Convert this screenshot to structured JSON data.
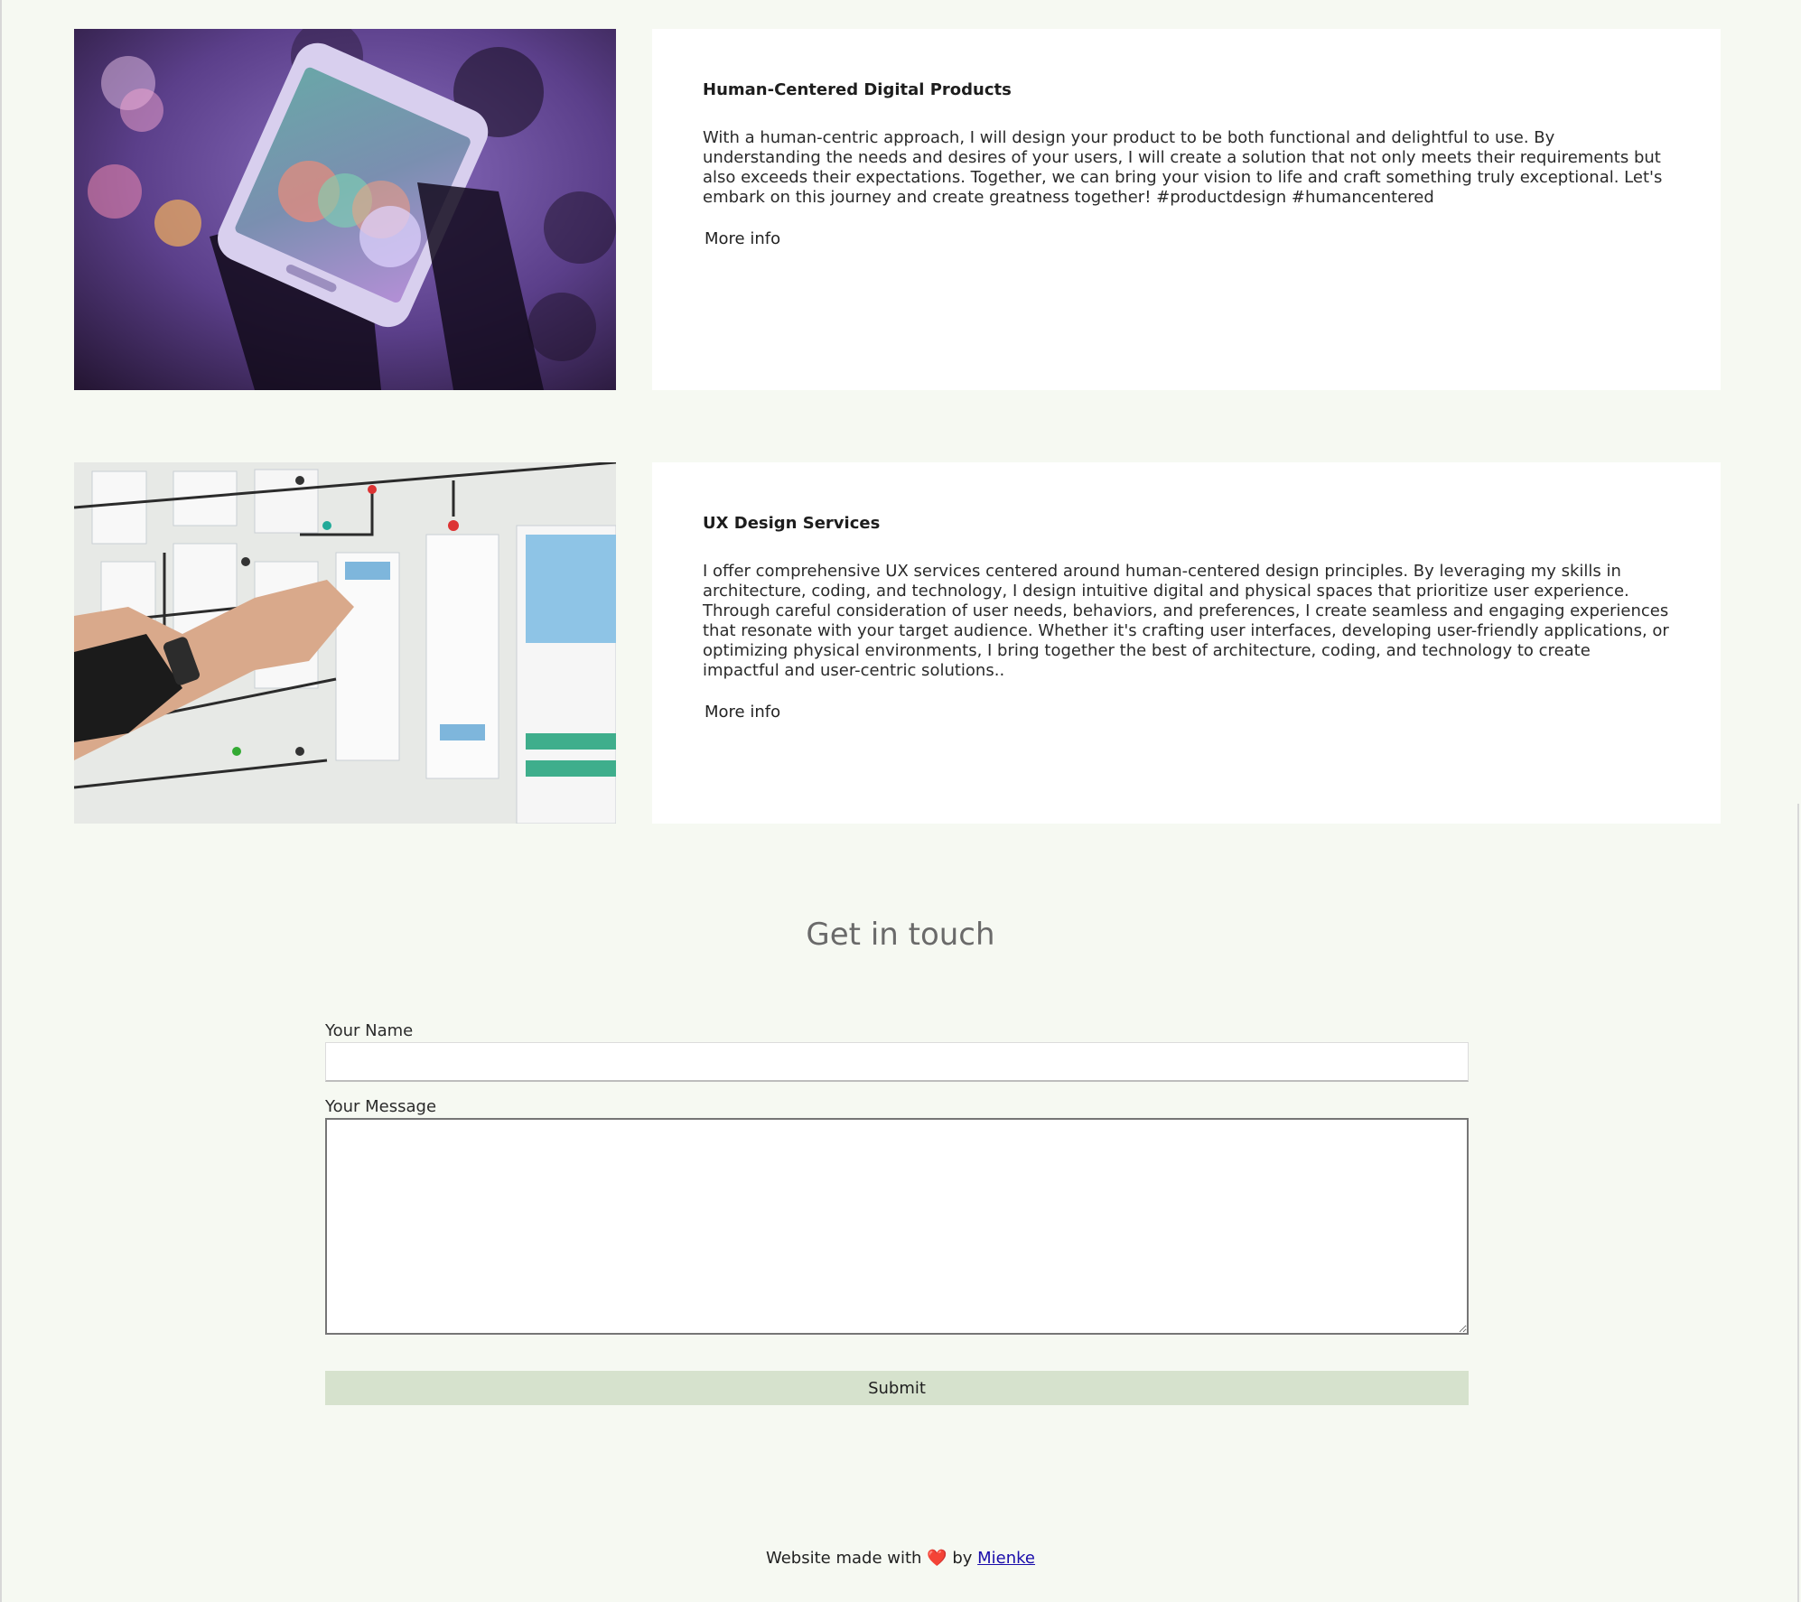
{
  "services": [
    {
      "title": "Human-Centered Digital Products",
      "description": "With a human-centric approach, I will design your product to be both functional and delightful to use. By understanding the needs and desires of your users, I will create a solution that not only meets their requirements but also exceeds their expectations. Together, we can bring your vision to life and craft something truly exceptional. Let's embark on this journey and create greatness together! #productdesign #humancentered",
      "more_label": "More info"
    },
    {
      "title": "UX Design Services",
      "description": "I offer comprehensive UX services centered around human-centered design principles. By leveraging my skills in architecture, coding, and technology, I design intuitive digital and physical spaces that prioritize user experience. Through careful consideration of user needs, behaviors, and preferences, I create seamless and engaging experiences that resonate with your target audience. Whether it's crafting user interfaces, developing user-friendly applications, or optimizing physical environments, I bring together the best of architecture, coding, and technology to create impactful and user-centric solutions..",
      "more_label": "More info"
    }
  ],
  "contact": {
    "title": "Get in touch",
    "name_label": "Your Name",
    "name_value": "",
    "message_label": "Your Message",
    "message_value": "",
    "submit_label": "Submit"
  },
  "footer": {
    "prefix": "Website made with",
    "heart": "❤️",
    "by": "by",
    "author": "Mienke"
  },
  "colors": {
    "page_background": "#f6f9f2",
    "card_background": "#ffffff",
    "submit_background": "#d6e2cd",
    "link": "#1a0dab"
  }
}
